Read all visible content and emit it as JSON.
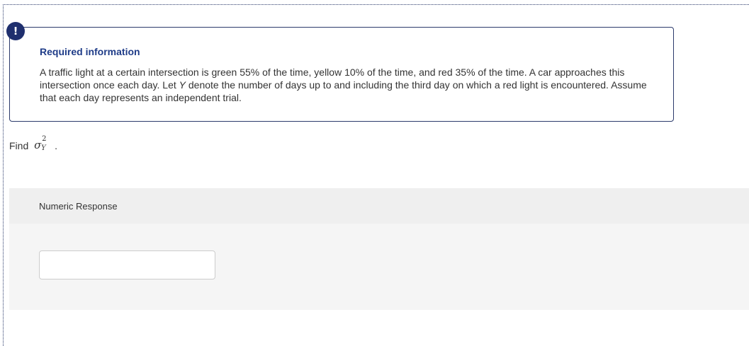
{
  "alert": {
    "icon": "exclamation-icon",
    "glyph": "!",
    "color": "#1f2f6e"
  },
  "required_info": {
    "title": "Required information",
    "text_part1": "A traffic light at a certain intersection is green 55% of the time, yellow 10% of the time, and red 35% of the time. A car approaches this intersection once each day. Let ",
    "variable": "Y",
    "text_part2": " denote the number of days up to and including the third day on which a red light is encountered. Assume that each day represents an independent trial."
  },
  "question": {
    "prefix": "Find",
    "symbol": "σ",
    "superscript": "2",
    "subscript": "Y",
    "suffix": "."
  },
  "response": {
    "label": "Numeric Response",
    "value": "",
    "placeholder": ""
  }
}
